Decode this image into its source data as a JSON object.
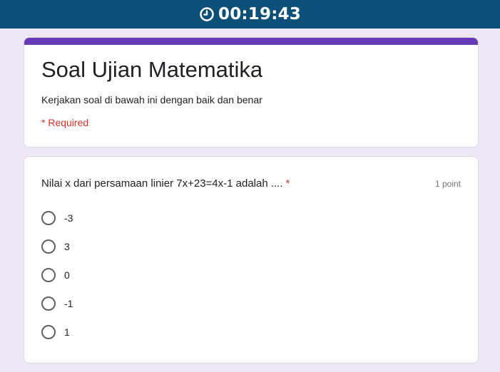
{
  "timer": {
    "icon": "clock-icon",
    "value": "00:19:43"
  },
  "colors": {
    "timer_bar": "#0c5079",
    "accent": "#673ab7",
    "background": "#ede7f6",
    "required": "#d93025"
  },
  "form": {
    "title": "Soal Ujian Matematika",
    "description": "Kerjakan soal di bawah ini dengan baik dan benar",
    "required_note": "* Required"
  },
  "question": {
    "text": "Nilai x dari persamaan linier 7x+23=4x-1 adalah ....",
    "required_marker": "*",
    "points": "1 point",
    "options": [
      {
        "label": "-3"
      },
      {
        "label": "3"
      },
      {
        "label": "0"
      },
      {
        "label": "-1"
      },
      {
        "label": "1"
      }
    ]
  }
}
